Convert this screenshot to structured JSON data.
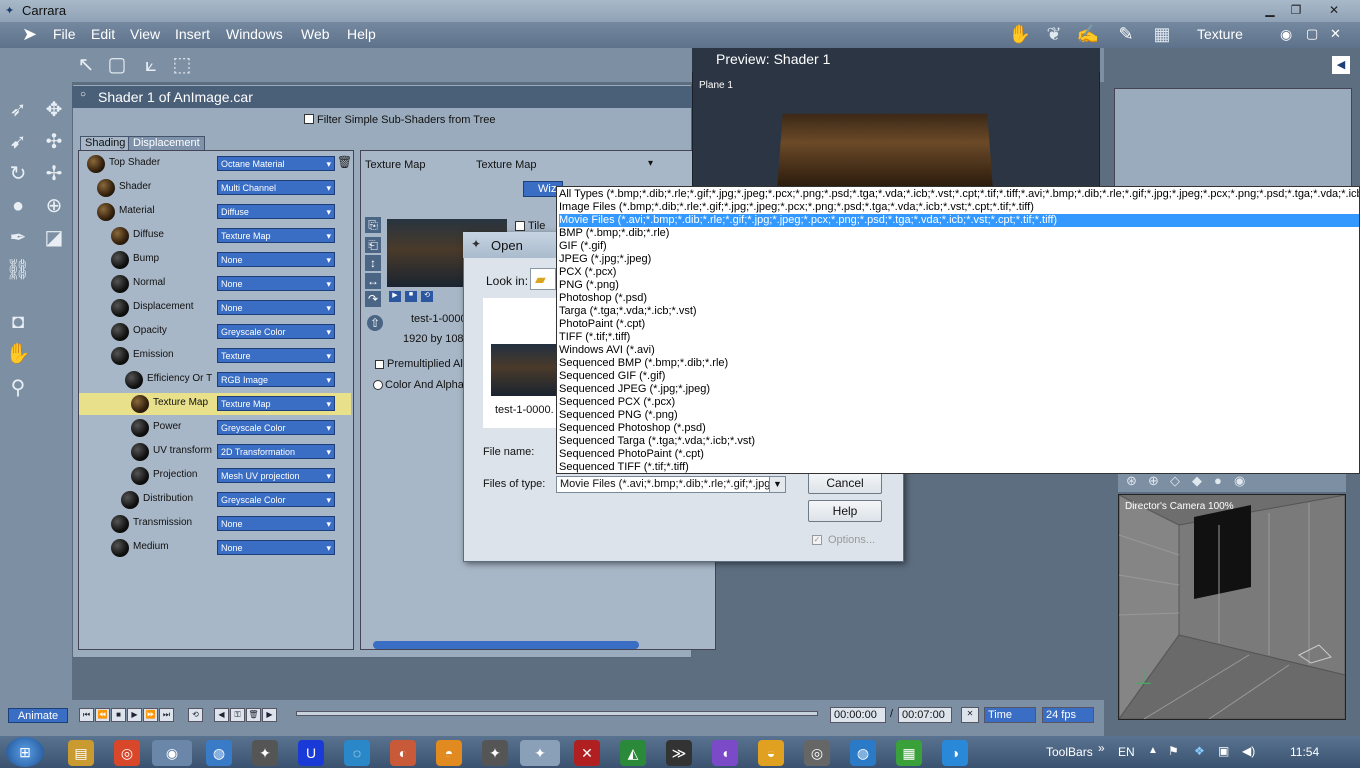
{
  "window": {
    "title": "Carrara"
  },
  "menu": [
    "File",
    "Edit",
    "View",
    "Insert",
    "Windows",
    "Web",
    "Help"
  ],
  "room": {
    "label": "Texture"
  },
  "shader_panel": {
    "title": "Shader 1 of AnImage.car",
    "filter_label": "Filter Simple Sub-Shaders from Tree",
    "tabs": [
      "Shading",
      "Displacement"
    ],
    "tree": [
      {
        "label": "Top Shader",
        "value": "Octane Material"
      },
      {
        "label": "Shader",
        "value": "Multi Channel"
      },
      {
        "label": "Material",
        "value": "Diffuse"
      },
      {
        "label": "Diffuse",
        "value": "Texture Map"
      },
      {
        "label": "Bump",
        "value": "None"
      },
      {
        "label": "Normal",
        "value": "None"
      },
      {
        "label": "Displacement",
        "value": "None"
      },
      {
        "label": "Opacity",
        "value": "Greyscale Color"
      },
      {
        "label": "Emission",
        "value": "Texture"
      },
      {
        "label": "Efficiency Or T",
        "value": "RGB Image"
      },
      {
        "label": "Texture Map",
        "value": "Texture Map"
      },
      {
        "label": "Power",
        "value": "Greyscale Color"
      },
      {
        "label": "UV transform",
        "value": "2D Transformation"
      },
      {
        "label": "Projection",
        "value": "Mesh UV projection"
      },
      {
        "label": "Distribution",
        "value": "Greyscale Color"
      },
      {
        "label": "Transmission",
        "value": "None"
      },
      {
        "label": "Medium",
        "value": "None"
      }
    ],
    "right_header_left": "Texture Map",
    "right_header_right": "Texture Map",
    "wizard_label": "Wiza",
    "tile_label": "Tile",
    "image_name": "test-1-0000",
    "image_size": "1920 by 1080",
    "premult_label": "Premultiplied Alpl",
    "color_alpha_label": "Color And Alpha"
  },
  "preview": {
    "title": "Preview: Shader 1",
    "object": "Plane 1"
  },
  "camera": {
    "label": "Director's Camera 100%"
  },
  "open_dialog": {
    "title": "Open",
    "look_in_label": "Look in:",
    "thumb_name": "test-1-0000.",
    "file_name_label": "File name:",
    "files_of_type_label": "Files of type:",
    "files_of_type_value": "Movie Files (*.avi;*.bmp;*.dib;*.rle;*.gif;*.jpg;*.",
    "cancel": "Cancel",
    "help": "Help",
    "options": "Options..."
  },
  "filetype_options": [
    "All Types (*.bmp;*.dib;*.rle;*.gif;*.jpg;*.jpeg;*.pcx;*.png;*.psd;*.tga;*.vda;*.icb;*.vst;*.cpt;*.tif;*.tiff;*.avi;*.bmp;*.dib;*.rle;*.gif;*.jpg;*.jpeg;*.pcx;*.png;*.psd;*.tga;*.vda;*.icb;*.vst",
    "Image Files (*.bmp;*.dib;*.rle;*.gif;*.jpg;*.jpeg;*.pcx;*.png;*.psd;*.tga;*.vda;*.icb;*.vst;*.cpt;*.tif;*.tiff)",
    "Movie Files (*.avi;*.bmp;*.dib;*.rle;*.gif;*.jpg;*.jpeg;*.pcx;*.png;*.psd;*.tga;*.vda;*.icb;*.vst;*.cpt;*.tif;*.tiff)",
    "BMP (*.bmp;*.dib;*.rle)",
    "GIF (*.gif)",
    "JPEG (*.jpg;*.jpeg)",
    "PCX (*.pcx)",
    "PNG (*.png)",
    "Photoshop (*.psd)",
    "Targa (*.tga;*.vda;*.icb;*.vst)",
    "PhotoPaint (*.cpt)",
    "TIFF (*.tif;*.tiff)",
    "Windows AVI (*.avi)",
    "Sequenced BMP (*.bmp;*.dib;*.rle)",
    "Sequenced GIF (*.gif)",
    "Sequenced JPEG (*.jpg;*.jpeg)",
    "Sequenced PCX (*.pcx)",
    "Sequenced PNG (*.png)",
    "Sequenced Photoshop (*.psd)",
    "Sequenced Targa (*.tga;*.vda;*.icb;*.vst)",
    "Sequenced PhotoPaint (*.cpt)",
    "Sequenced TIFF (*.tif;*.tiff)"
  ],
  "filetype_selected_index": 2,
  "timeline": {
    "animate": "Animate",
    "time_start": "00:00:00",
    "separator": "/",
    "time_end": "00:07:00",
    "mode": "Time",
    "fps": "24 fps"
  },
  "taskbar": {
    "toolbars": "ToolBars",
    "toolbars_chevron": "»",
    "lang": "EN",
    "clock": "11:54"
  },
  "colors": {
    "accent": "#3399ff",
    "highlight_row": "#e8e08a",
    "combo": "#3a6ec4"
  }
}
